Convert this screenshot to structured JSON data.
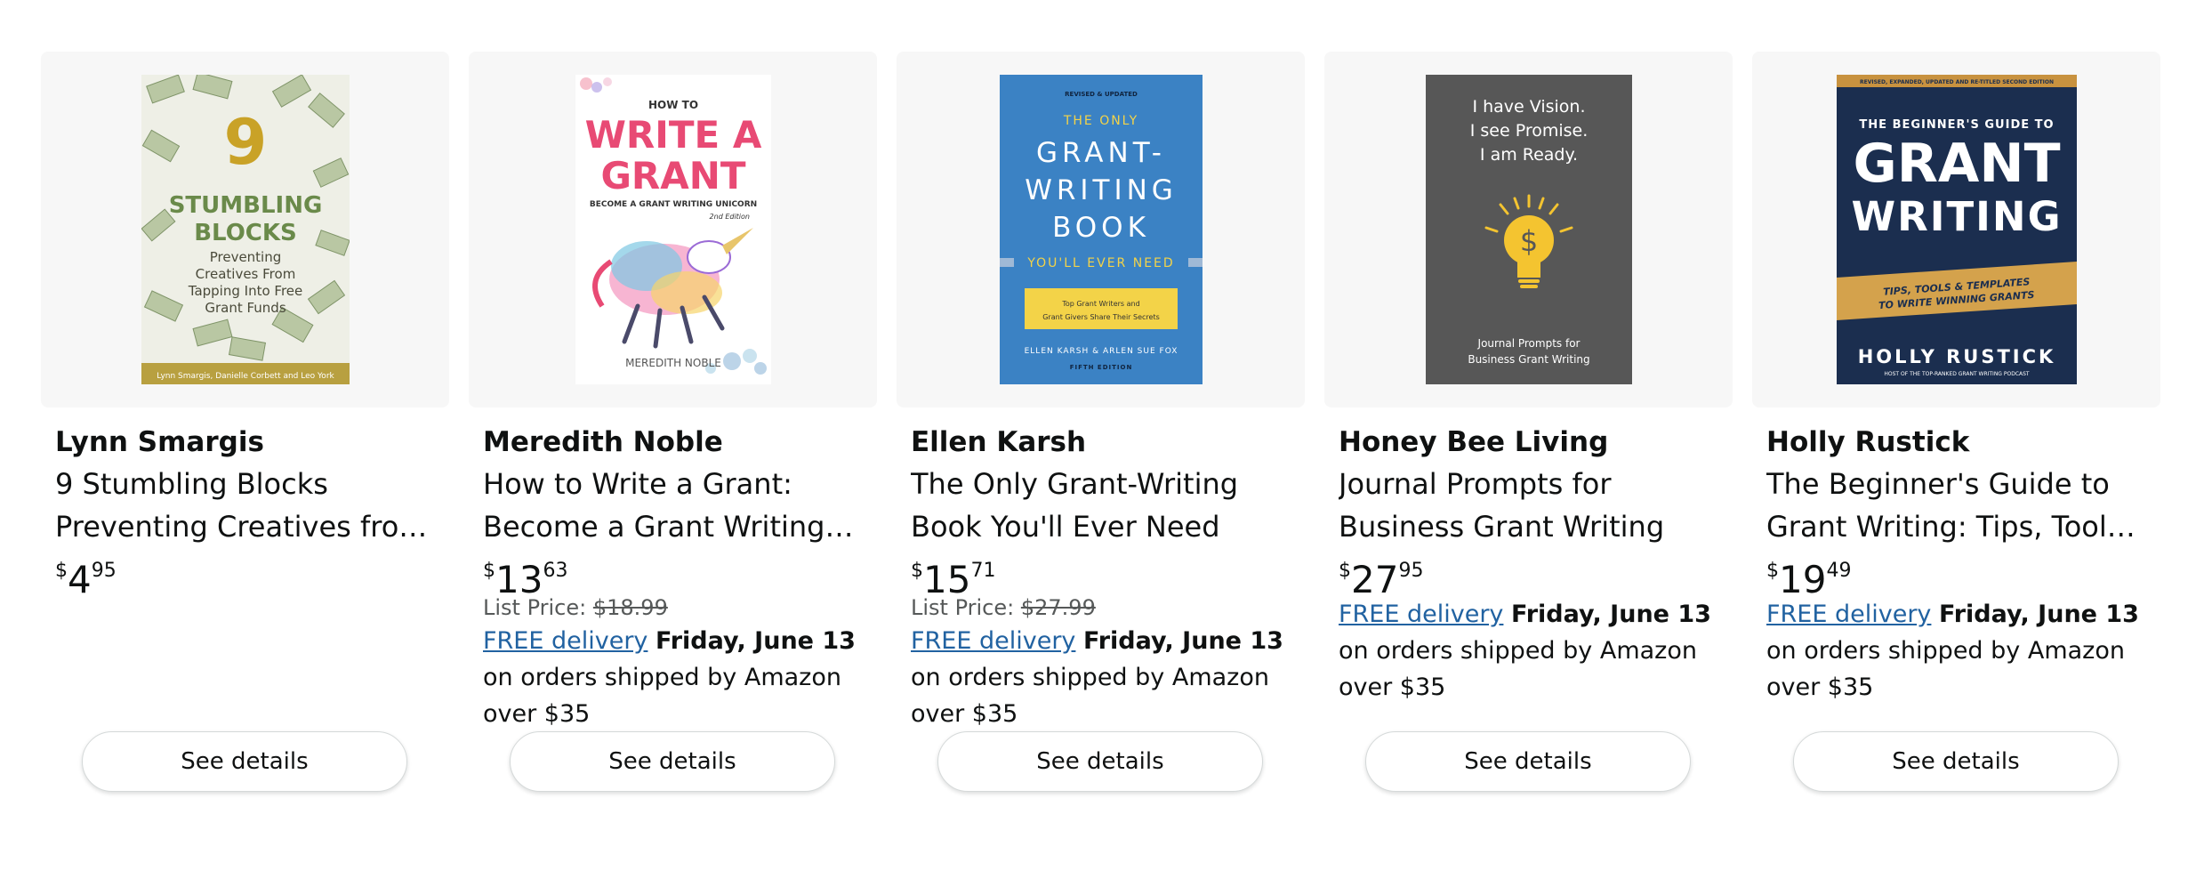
{
  "products": [
    {
      "author": "Lynn Smargis",
      "title": "9 Stumbling Blocks Preventing Creatives from Tapping Into Free Grant Funds",
      "price": {
        "symbol": "$",
        "whole": "4",
        "fraction": "95"
      },
      "list_price": null,
      "delivery": null,
      "button": "See details",
      "cover": {
        "number": "9",
        "title_lines": [
          "STUMBLING",
          "BLOCKS"
        ],
        "subtitle_lines": [
          "Preventing",
          "Creatives From",
          "Tapping Into Free",
          "Grant Funds"
        ],
        "authors": "Lynn Smargis, Danielle Corbett and Leo York"
      }
    },
    {
      "author": "Meredith Noble",
      "title": "How to Write a Grant: Become a Grant Writing Unicorn",
      "price": {
        "symbol": "$",
        "whole": "13",
        "fraction": "63"
      },
      "list_price": {
        "label": "List Price:",
        "value": "$18.99"
      },
      "delivery": {
        "link": "FREE delivery",
        "date": "Friday, June 13",
        "rest": " on orders shipped by Amazon over $35"
      },
      "button": "See details",
      "cover": {
        "top": "HOW TO",
        "title_lines": [
          "WRITE A",
          "GRANT"
        ],
        "subtitle": "BECOME A GRANT WRITING UNICORN",
        "edition": "2nd Edition",
        "author": "MEREDITH NOBLE"
      }
    },
    {
      "author": "Ellen Karsh",
      "title": "The Only Grant-Writing Book You'll Ever Need",
      "price": {
        "symbol": "$",
        "whole": "15",
        "fraction": "71"
      },
      "list_price": {
        "label": "List Price:",
        "value": "$27.99"
      },
      "delivery": {
        "link": "FREE delivery",
        "date": "Friday, June 13",
        "rest": " on orders shipped by Amazon over $35"
      },
      "button": "See details",
      "cover": {
        "top": "REVISED & UPDATED",
        "the_only": "THE ONLY",
        "title_lines": [
          "GRANT-",
          "WRITING",
          "BOOK"
        ],
        "tagline": "YOU'LL EVER NEED",
        "box_lines": [
          "Top Grant Writers and",
          "Grant Givers Share Their Secrets"
        ],
        "authors": "ELLEN KARSH & ARLEN SUE FOX",
        "edition": "FIFTH EDITION"
      }
    },
    {
      "author": "Honey Bee Living",
      "title": "Journal Prompts for Business Grant Writing",
      "price": {
        "symbol": "$",
        "whole": "27",
        "fraction": "95"
      },
      "list_price": null,
      "delivery": {
        "link": "FREE delivery",
        "date": "Friday, June 13",
        "rest": " on orders shipped by Amazon over $35"
      },
      "button": "See details",
      "cover": {
        "lines": [
          "I have Vision.",
          "I see Promise.",
          "I am Ready."
        ],
        "symbol": "$",
        "bottom_lines": [
          "Journal Prompts for",
          "Business Grant Writing"
        ]
      }
    },
    {
      "author": "Holly Rustick",
      "title": "The Beginner's Guide to Grant Writing: Tips, Tools, & Templates to Write Winning Grants",
      "price": {
        "symbol": "$",
        "whole": "19",
        "fraction": "49"
      },
      "list_price": null,
      "delivery": {
        "link": "FREE delivery",
        "date": "Friday, June 13",
        "rest": " on orders shipped by Amazon over $35"
      },
      "button": "See details",
      "cover": {
        "top": "REVISED, EXPANDED, UPDATED AND RE-TITLED SECOND EDITION",
        "guide": "THE BEGINNER'S GUIDE TO",
        "title_lines": [
          "GRANT",
          "WRITING"
        ],
        "banner_lines": [
          "TIPS, TOOLS & TEMPLATES",
          "TO WRITE WINNING GRANTS"
        ],
        "author": "HOLLY RUSTICK",
        "bio": "HOST OF THE TOP-RANKED GRANT WRITING PODCAST"
      }
    }
  ],
  "colors": {
    "link": "#2162a1",
    "card_bg": "#f7f7f7",
    "text": "#0f1111",
    "muted": "#565959"
  }
}
